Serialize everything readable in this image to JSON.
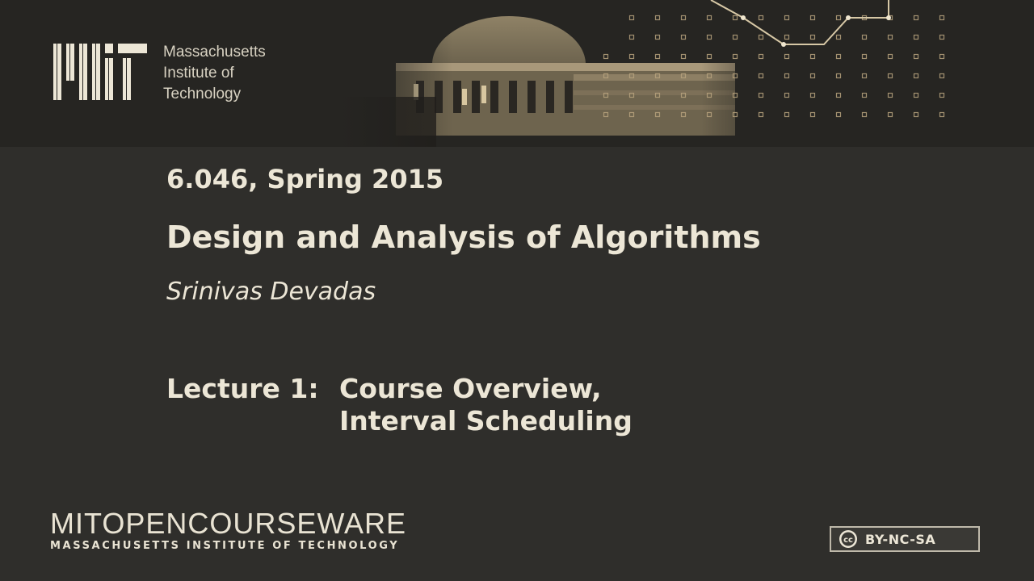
{
  "header": {
    "institution_lines": [
      "Massachusetts",
      "Institute of",
      "Technology"
    ]
  },
  "slide": {
    "course": "6.046, Spring 2015",
    "title": "Design and Analysis of Algorithms",
    "author": "Srinivas Devadas",
    "lecture_label": "Lecture 1:",
    "lecture_title_lines": [
      "Course Overview,",
      "Interval Scheduling"
    ]
  },
  "footer": {
    "ocw_part1": "MIT",
    "ocw_part2": "OPEN",
    "ocw_part3": "COURSEWARE",
    "ocw_subtitle": "MASSACHUSETTS INSTITUTE OF TECHNOLOGY",
    "license": "BY-NC-SA",
    "license_icon_text": "cc"
  },
  "colors": {
    "background": "#2f2e2b",
    "banner": "#262522",
    "text": "#ece6d6",
    "accent_gold": "#b8a37e"
  },
  "icons": [
    "mit-logo-icon",
    "dome-image",
    "circuit-dots-graphic",
    "creative-commons-icon"
  ]
}
